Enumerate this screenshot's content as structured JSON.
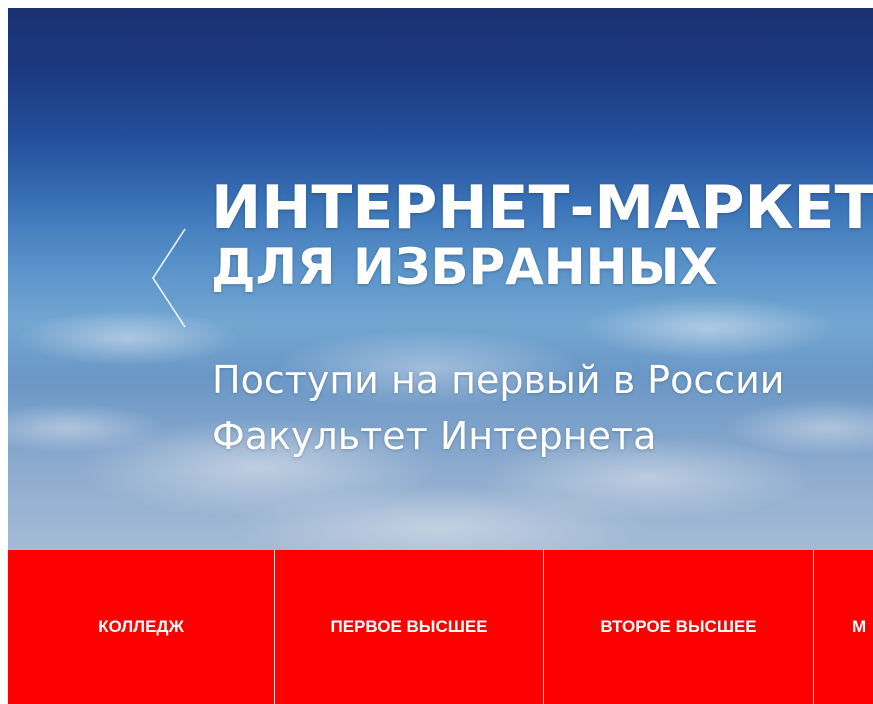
{
  "hero": {
    "headline_line1": "ИНТЕРНЕТ-МАРКЕТ",
    "headline_line2": "ДЛЯ ИЗБРАННЫХ",
    "subline_line1": "Поступи на первый в России",
    "subline_line2": "Факультет Интернета",
    "prev_arrow_icon": "chevron-left-icon"
  },
  "nav": {
    "items": [
      {
        "label": "КОЛЛЕДЖ"
      },
      {
        "label": "ПЕРВОЕ ВЫСШЕЕ"
      },
      {
        "label": "ВТОРОЕ ВЫСШЕЕ"
      },
      {
        "label": "М"
      }
    ],
    "background_color": "#fe0000",
    "text_color": "#ffffff"
  }
}
